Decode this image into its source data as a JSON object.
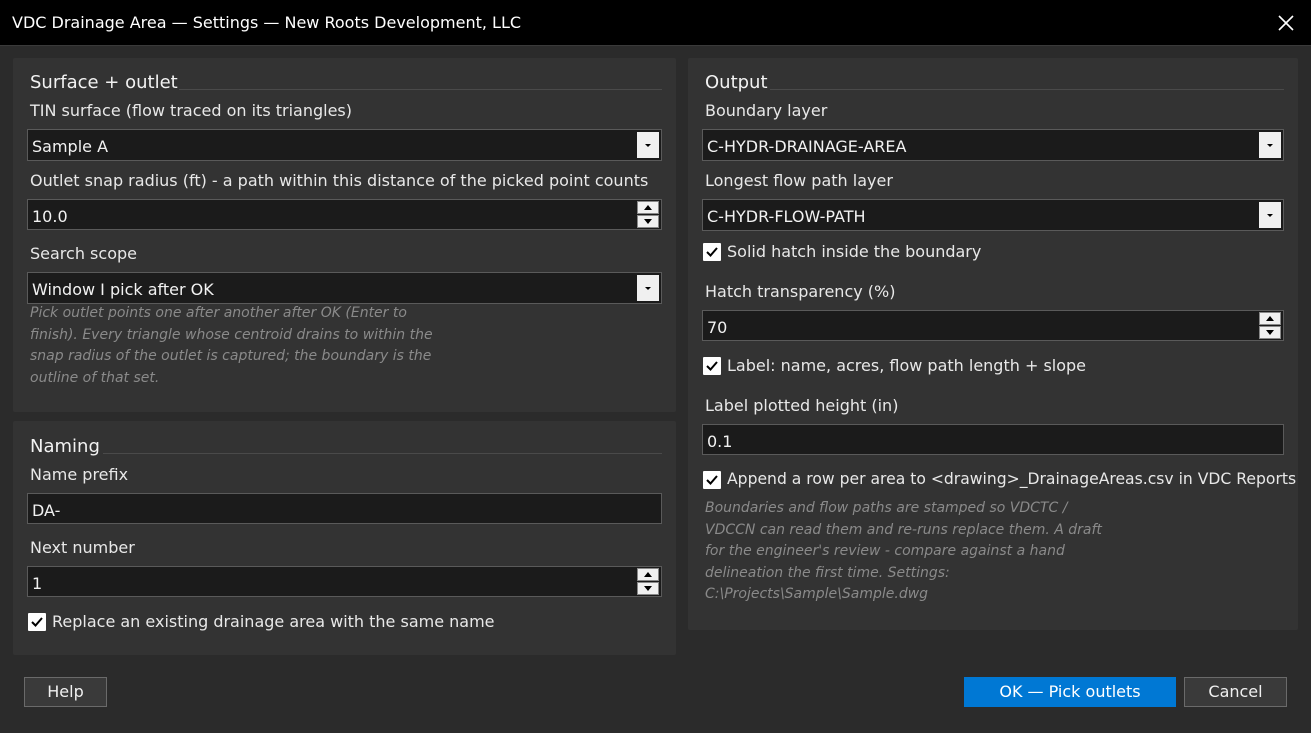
{
  "window": {
    "title": "VDC Drainage Area — Settings — New Roots Development, LLC"
  },
  "surface_outlet": {
    "title": "Surface + outlet",
    "tin_label": "TIN surface (flow traced on its triangles)",
    "tin_value": "Sample A",
    "snap_label": "Outlet snap radius (ft) - a path within this distance of the picked point counts",
    "snap_value": "10.0",
    "scope_label": "Search scope",
    "scope_value": "Window I pick after OK",
    "hint": [
      "Pick outlet points one after another after OK (Enter to",
      "finish). Every triangle whose centroid drains to within the",
      "snap radius of the outlet is captured; the boundary is the",
      "outline of that set."
    ]
  },
  "naming": {
    "title": "Naming",
    "prefix_label": "Name prefix",
    "prefix_value": "DA-",
    "next_label": "Next number",
    "next_value": "1",
    "replace_label": "Replace an existing drainage area with the same name",
    "replace_checked": true
  },
  "output": {
    "title": "Output",
    "boundary_label": "Boundary layer",
    "boundary_value": "C-HYDR-DRAINAGE-AREA",
    "flow_label": "Longest flow path layer",
    "flow_value": "C-HYDR-FLOW-PATH",
    "hatch_label": "Solid hatch inside the boundary",
    "hatch_checked": true,
    "transparency_label": "Hatch transparency (%)",
    "transparency_value": "70",
    "label_label": "Label: name, acres, flow path length + slope",
    "label_checked": true,
    "height_label": "Label plotted height (in)",
    "height_value": "0.1",
    "append_label": "Append a row per area to <drawing>_DrainageAreas.csv in VDC Reports",
    "append_checked": true,
    "hint": [
      "Boundaries and flow paths are stamped so VDCTC /",
      "VDCCN can read them and re-runs replace them. A draft",
      "for the engineer's review - compare against a hand",
      "delineation the first time. Settings:",
      "C:\\Projects\\Sample\\Sample.dwg"
    ]
  },
  "buttons": {
    "help": "Help",
    "ok": "OK — Pick outlets",
    "cancel": "Cancel"
  },
  "colors": {
    "accent": "#0078d4",
    "background": "#2b2b2b",
    "panel": "#333333",
    "titlebar": "#000000"
  }
}
